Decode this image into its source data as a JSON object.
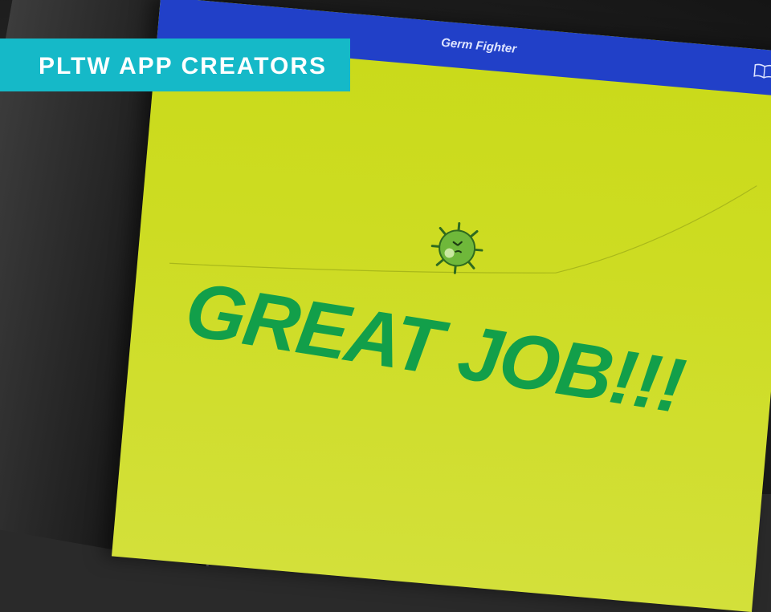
{
  "banner": {
    "text": "PLTW APP CREATORS"
  },
  "app": {
    "title": "Germ Fighter",
    "message": "GREAT JOB!!!",
    "icons": {
      "book": "book-icon",
      "germ": "germ-icon"
    }
  },
  "colors": {
    "banner_bg": "#15b9c8",
    "topbar": "#2140c8",
    "screen_bg": "#cddc22",
    "message_text": "#129f4a"
  }
}
